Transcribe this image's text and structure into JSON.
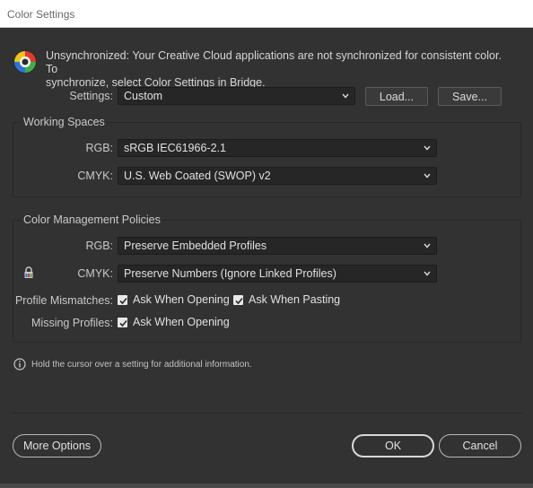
{
  "window": {
    "title": "Color Settings"
  },
  "sync": {
    "icon": "color-sync-status-icon",
    "message_line1": "Unsynchronized: Your Creative Cloud applications are not synchronized for consistent color. To",
    "message_line2": "synchronize, select Color Settings in Bridge."
  },
  "settings": {
    "label": "Settings:",
    "value": "Custom",
    "load_label": "Load...",
    "save_label": "Save..."
  },
  "working_spaces": {
    "title": "Working Spaces",
    "rgb_label": "RGB:",
    "rgb_value": "sRGB IEC61966-2.1",
    "cmyk_label": "CMYK:",
    "cmyk_value": "U.S. Web Coated (SWOP) v2"
  },
  "policies": {
    "title": "Color Management Policies",
    "rgb_label": "RGB:",
    "rgb_value": "Preserve Embedded Profiles",
    "cmyk_label": "CMYK:",
    "cmyk_value": "Preserve Numbers (Ignore Linked Profiles)",
    "profile_mismatches_label": "Profile Mismatches:",
    "ask_when_opening_label": "Ask When Opening",
    "ask_when_opening_checked": true,
    "ask_when_pasting_label": "Ask When Pasting",
    "ask_when_pasting_checked": true,
    "missing_profiles_label": "Missing Profiles:",
    "missing_ask_when_opening_label": "Ask When Opening",
    "missing_ask_when_opening_checked": true
  },
  "hint": {
    "text": "Hold the cursor over a setting for additional information."
  },
  "footer": {
    "more_options_label": "More Options",
    "ok_label": "OK",
    "cancel_label": "Cancel"
  }
}
